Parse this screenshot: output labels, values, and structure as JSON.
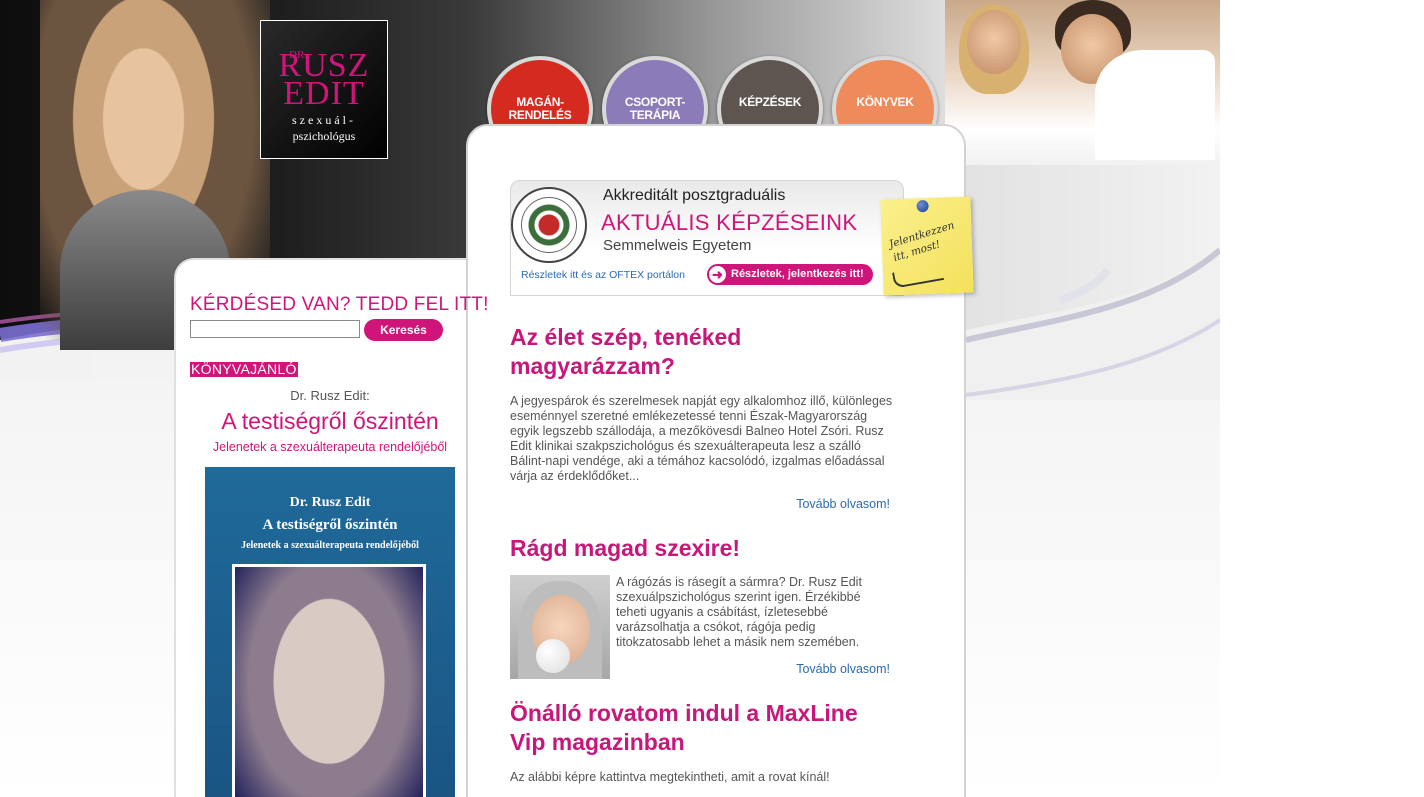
{
  "logo": {
    "dr": "DR.",
    "name_line1": "RUSZ",
    "name_line2": "EDIT",
    "subtitle_line1": "szexuál-",
    "subtitle_line2": "pszichológus"
  },
  "nav": [
    {
      "label": "MAGÁN-\nRENDELÉS",
      "color": "#d52a1f"
    },
    {
      "label": "CSOPORT-\nTERÁPIA",
      "color": "#8b7bb8"
    },
    {
      "label": "KÉPZÉSEK",
      "color": "#5e5550"
    },
    {
      "label": "KÖNYVEK",
      "color": "#ef8a5a"
    }
  ],
  "sidebar": {
    "ask_title": "KÉRDÉSED VAN? TEDD FEL ITT!",
    "search_value": "",
    "search_button": "Keresés",
    "book_badge": "KÖNYVAJÁNLÓ",
    "book_author": "Dr. Rusz Edit:",
    "book_title": "A testiségről őszintén",
    "book_subtitle": "Jelenetek a szexuálterapeuta rendelőjéből",
    "cover": {
      "author": "Dr. Rusz Edit",
      "title": "A testiségről őszintén",
      "subtitle": "Jelenetek a szexuálterapeuta rendelőjéből"
    }
  },
  "accredited": {
    "line1": "Akkreditált posztgraduális",
    "line2": "AKTUÁLIS KÉPZÉSEINK",
    "line3": "Semmelweis Egyetem",
    "details_link": "Részletek itt és az OFTEX portálon",
    "cta_button": "Részletek, jelentkezés itt!",
    "sticky_note": "Jelentkezzen itt, most!"
  },
  "articles": [
    {
      "title": "Az élet szép, tenéked magyarázzam?",
      "text": "A jegyespárok és szerelmesek napját egy alkalomhoz illő, különleges eseménnyel szeretné emlékezetessé tenni Észak-Magyarország egyik legszebb szállodája, a mezőkövesdi Balneo Hotel Zsóri. Rusz Edit klinikai szakpszichológus és szexuálterapeuta lesz a szálló Bálint-napi vendége, aki a témához kacsolódó, izgalmas előadással várja az érdeklődőket...",
      "more": "Tovább olvasom!"
    },
    {
      "title": "Rágd magad szexire!",
      "text": "A rágózás is rásegít a sármra? Dr. Rusz Edit szexuálpszichológus szerint igen. Érzékibbé teheti ugyanis a csábítást, ízletesebbé varázsolhatja a csókot, rágója pedig titokzatosabb lehet a másik nem szemében.",
      "more": "Tovább olvasom!"
    },
    {
      "title": "Önálló rovatom indul a MaxLine Vip magazinban",
      "text": "Az alábbi képre kattintva megtekintheti, amit a rovat kínál!"
    }
  ],
  "colors": {
    "accent": "#d0157a",
    "link": "#2a6bb0"
  }
}
